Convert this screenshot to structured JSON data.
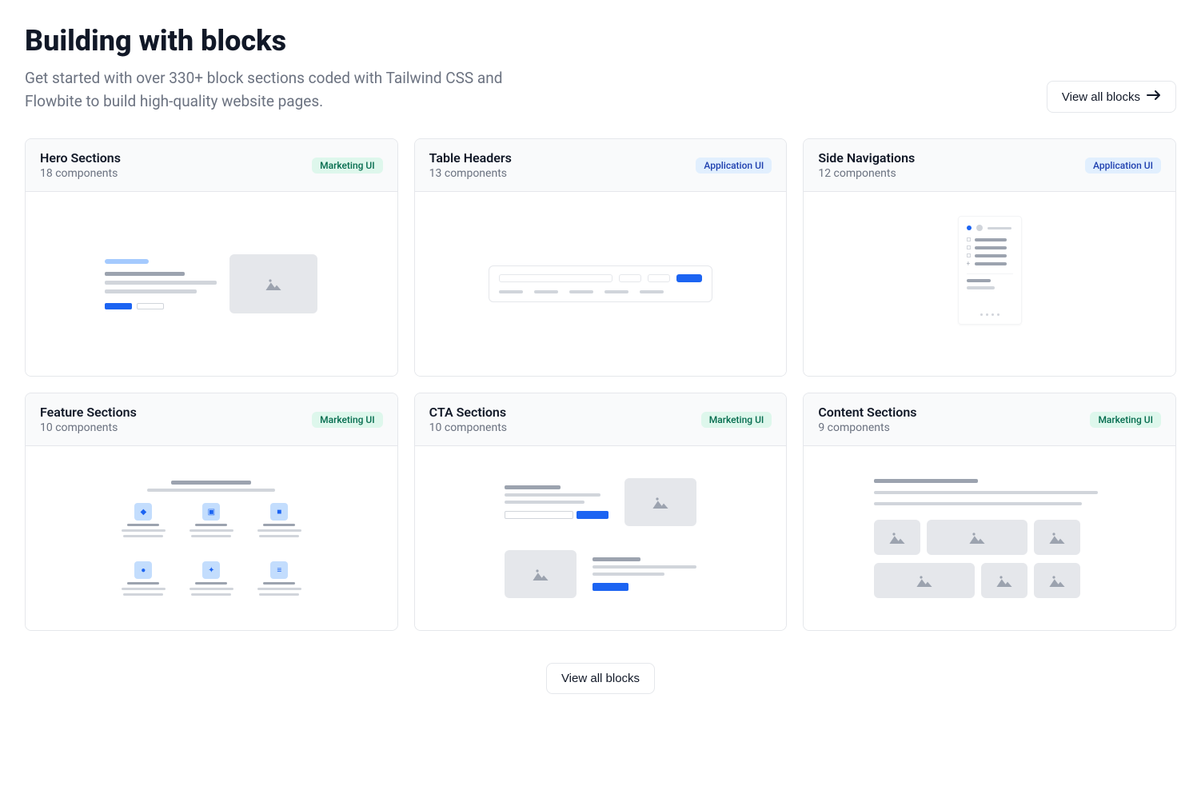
{
  "header": {
    "title": "Building with blocks",
    "subtitle": "Get started with over 330+ block sections coded with Tailwind CSS and Flowbite to build high-quality website pages.",
    "view_all_label": "View all blocks"
  },
  "badges": {
    "marketing": "Marketing UI",
    "application": "Application UI"
  },
  "cards": [
    {
      "title": "Hero Sections",
      "meta": "18 components",
      "badge": "marketing"
    },
    {
      "title": "Table Headers",
      "meta": "13 components",
      "badge": "application"
    },
    {
      "title": "Side Navigations",
      "meta": "12 components",
      "badge": "application"
    },
    {
      "title": "Feature Sections",
      "meta": "10 components",
      "badge": "marketing"
    },
    {
      "title": "CTA Sections",
      "meta": "10 components",
      "badge": "marketing"
    },
    {
      "title": "Content Sections",
      "meta": "9 components",
      "badge": "marketing"
    }
  ],
  "footer": {
    "view_all_label": "View all blocks"
  }
}
